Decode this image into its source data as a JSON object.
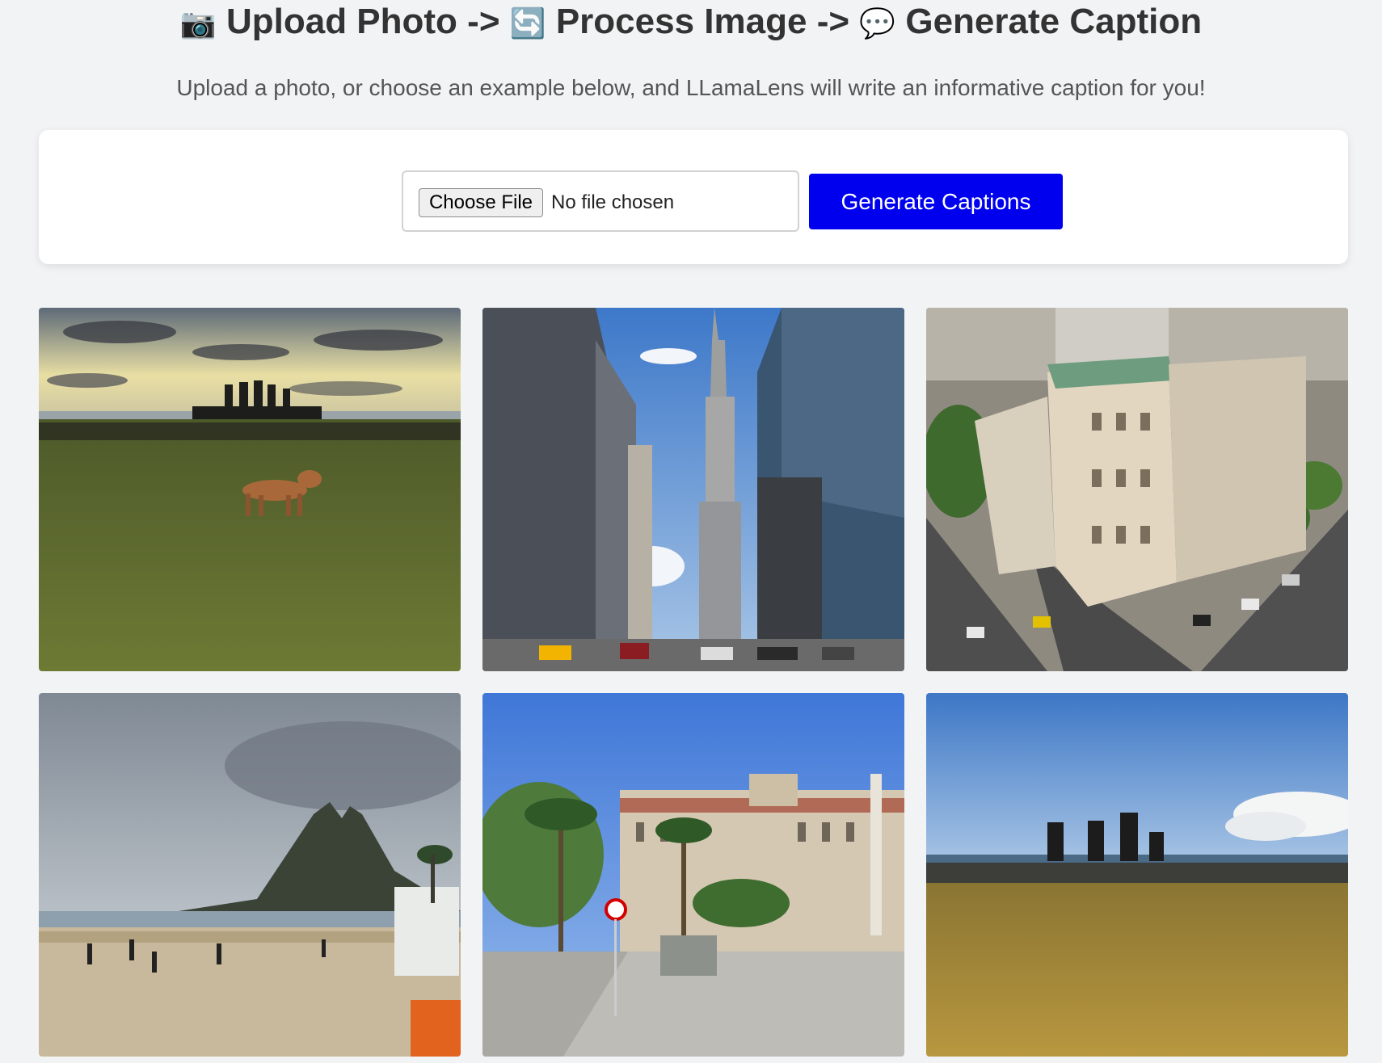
{
  "header": {
    "step1_icon": "camera-icon",
    "step1": "Upload Photo",
    "arrow": "->",
    "step2_icon": "refresh-icon",
    "step2": "Process Image",
    "step3_icon": "speech-bubble-icon",
    "step3": "Generate Caption",
    "subtitle": "Upload a photo, or choose an example below, and LLamaLens will write an informative caption for you!"
  },
  "upload": {
    "choose_file_label": "Choose File",
    "no_file_text": "No file chosen",
    "generate_label": "Generate Captions"
  },
  "colors": {
    "background": "#f2f3f5",
    "accent_button": "#0000ee",
    "card": "#ffffff"
  },
  "gallery": {
    "images": [
      {
        "name": "example-image-dog-moai-sunset"
      },
      {
        "name": "example-image-empire-state-street"
      },
      {
        "name": "example-image-corner-building-aerial"
      },
      {
        "name": "example-image-beach-mountain"
      },
      {
        "name": "example-image-palace-palm-trees"
      },
      {
        "name": "example-image-moai-field"
      }
    ]
  }
}
